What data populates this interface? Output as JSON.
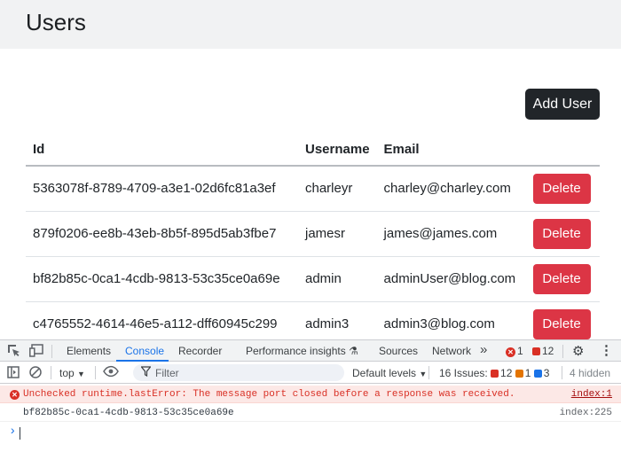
{
  "app": {
    "title": "Users",
    "add_button": "Add User",
    "table": {
      "headers": {
        "id": "Id",
        "username": "Username",
        "email": "Email"
      },
      "rows": [
        {
          "id": "5363078f-8789-4709-a3e1-02d6fc81a3ef",
          "username": "charleyr",
          "email": "charley@charley.com",
          "action": "Delete"
        },
        {
          "id": "879f0206-ee8b-43eb-8b5f-895d5ab3fbe7",
          "username": "jamesr",
          "email": "james@james.com",
          "action": "Delete"
        },
        {
          "id": "bf82b85c-0ca1-4cdb-9813-53c35ce0a69e",
          "username": "admin",
          "email": "adminUser@blog.com",
          "action": "Delete"
        },
        {
          "id": "c4765552-4614-46e5-a112-dff60945c299",
          "username": "admin3",
          "email": "admin3@blog.com",
          "action": "Delete"
        }
      ]
    }
  },
  "devtools": {
    "tabs": [
      "Elements",
      "Console",
      "Recorder",
      "Performance insights",
      "Sources",
      "Network"
    ],
    "active_tab": "Console",
    "more_tabs": "»",
    "error_count": "1",
    "issue_count": "12",
    "context": "top",
    "filter_placeholder": "Filter",
    "levels": "Default levels",
    "issues_label": "16 Issues:",
    "issues_error": "12",
    "issues_warning": "1",
    "issues_info": "3",
    "hidden": "4 hidden",
    "messages": [
      {
        "type": "error",
        "text": "Unchecked runtime.lastError: The message port closed before a response was received.",
        "source": "index:1"
      },
      {
        "type": "log",
        "text": "bf82b85c-0ca1-4cdb-9813-53c35ce0a69e",
        "source": "index:225"
      }
    ],
    "prompt_symbol": "›",
    "colors": {
      "accent": "#1a73e8",
      "error": "#d93025",
      "delete": "#dc3545",
      "dark_button": "#212529"
    }
  }
}
